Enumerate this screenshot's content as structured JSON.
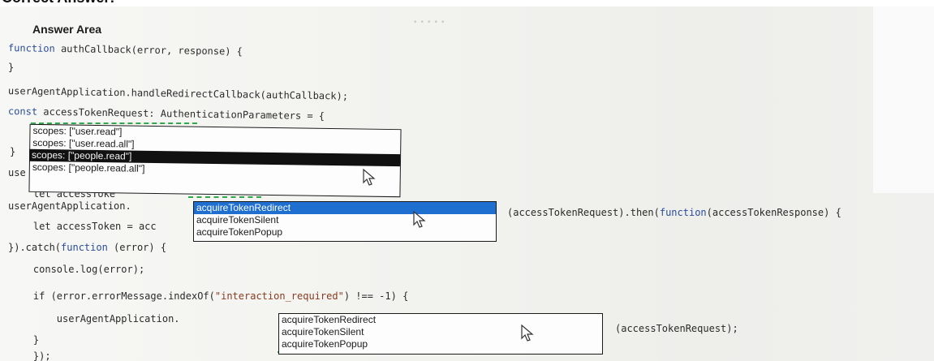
{
  "header": {
    "title": "Correct Answer:"
  },
  "answer_area": {
    "title": "Answer Area"
  },
  "code": {
    "line1_kw": "function",
    "line1_rest": " authCallback(error, response) {",
    "line2": "}",
    "line3": "userAgentApplication.handleRedirectCallback(authCallback);",
    "line4_kw": "const",
    "line4_rest": " accessTokenRequest: AuthenticationParameters = {",
    "line6": "}",
    "line7": "use",
    "line8": "    let accessToke",
    "line9_left": "userAgentApplication.",
    "line9_right_a": "(accessTokenRequest).then(",
    "line9_right_kw": "function",
    "line9_right_b": "(accessTokenResponse) {",
    "line10": "    let accessToken = acc",
    "line11_a": "}).catch(",
    "line11_kw": "function",
    "line11_b": " (error) {",
    "line12": "    console.log(error);",
    "line13_a": "    if (error.errorMessage.indexOf(",
    "line13_str": "\"interaction_required\"",
    "line13_b": ") !== -1) {",
    "line14": "        userAgentApplication.",
    "line14_right": "(accessTokenRequest);",
    "line15": "    }",
    "line16": "    });"
  },
  "dropdown_scopes": {
    "options": [
      "scopes: [\"user.read\"]",
      "scopes: [\"user.read.all\"]",
      "scopes: [\"people.read\"]",
      "scopes: [\"people.read.all\"]"
    ],
    "selected": "scopes: [\"people.read\"]"
  },
  "dropdown_acquire_1": {
    "options": [
      "acquireTokenRedirect",
      "acquireTokenSilent",
      "acquireTokenPopup"
    ],
    "selected": "acquireTokenRedirect"
  },
  "dropdown_acquire_2": {
    "options": [
      "acquireTokenRedirect",
      "acquireTokenSilent",
      "acquireTokenPopup"
    ],
    "selected": "acquireTokenPopup"
  },
  "icons": {
    "cursor": "mouse-pointer-icon",
    "answer_marker": "dashed-answer-marker"
  },
  "colors": {
    "keyword": "#2a4c9a",
    "selected_dark": "#111111",
    "selected_blue": "#1e6fd0",
    "answer_marker": "#2fa84a"
  }
}
